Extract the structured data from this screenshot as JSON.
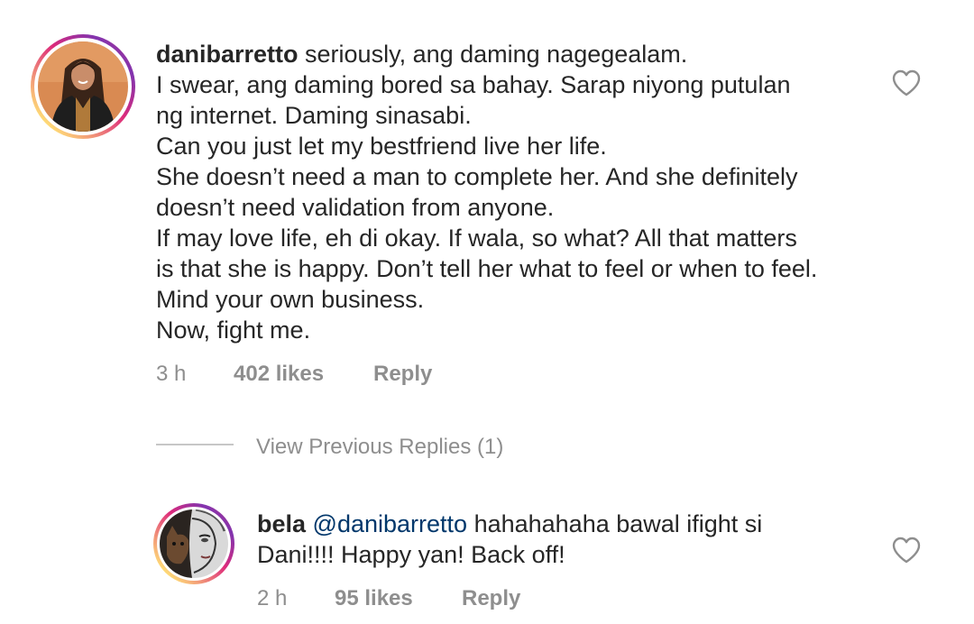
{
  "comments": [
    {
      "username": "danibarretto",
      "lines": [
        " seriously, ang daming nagegealam.",
        "I swear, ang daming bored sa bahay. Sarap niyong putulan",
        "ng internet. Daming sinasabi.",
        "Can you just let my bestfriend live her life.",
        "She doesn’t need a man to complete her. And she definitely",
        "doesn’t need validation from anyone.",
        "If may love life, eh di okay. If wala, so what? All that matters",
        "is that she is happy. Don’t tell her what to feel or when to feel.",
        "Mind your own business.",
        "Now, fight me."
      ],
      "time": "3 h",
      "likes": "402 likes",
      "reply_label": "Reply",
      "icon": "heart-outline-icon"
    }
  ],
  "thread": {
    "view_previous_replies": "View Previous Replies (1)"
  },
  "replies": [
    {
      "username": "bela",
      "mention": "@danibarretto",
      "line1_rest": " hahahahaha bawal ifight si",
      "line2": "Dani!!!! Happy yan! Back off!",
      "time": "2 h",
      "likes": "95 likes",
      "reply_label": "Reply",
      "icon": "heart-outline-icon"
    }
  ],
  "colors": {
    "text": "#262626",
    "meta": "#8e8e8e",
    "mention": "#00376b",
    "divider": "#c7c7c7"
  }
}
